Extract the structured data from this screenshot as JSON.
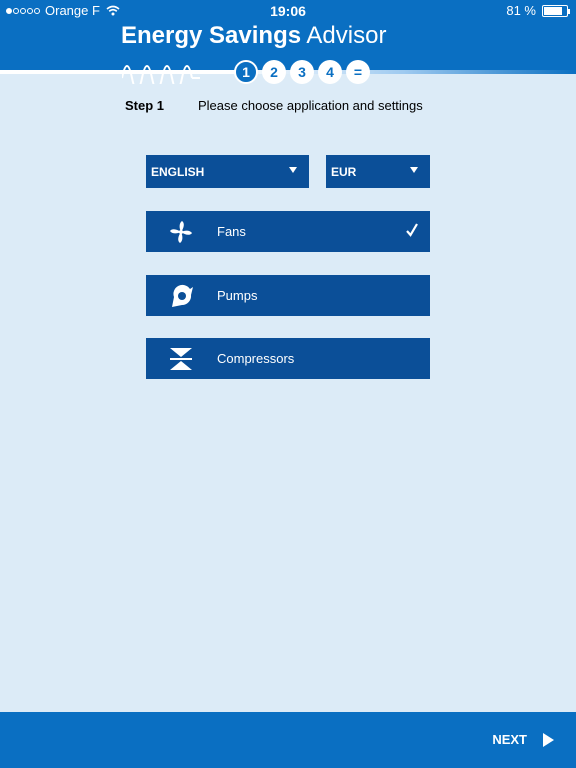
{
  "status_bar": {
    "carrier": "Orange F",
    "time": "19:06",
    "battery": "81 %",
    "battery_level": 0.81,
    "signal_bars": 1
  },
  "header": {
    "title_bold": "Energy Savings",
    "title_light": "Advisor"
  },
  "steps": {
    "items": [
      "1",
      "2",
      "3",
      "4",
      "="
    ],
    "active_index": 0
  },
  "step_header": {
    "label": "Step 1",
    "description": "Please choose application and settings"
  },
  "settings": {
    "language": "ENGLISH",
    "currency": "EUR"
  },
  "applications": [
    {
      "label": "Fans",
      "icon": "fan-icon",
      "selected": true
    },
    {
      "label": "Pumps",
      "icon": "pump-icon",
      "selected": false
    },
    {
      "label": "Compressors",
      "icon": "compressor-icon",
      "selected": false
    }
  ],
  "footer": {
    "next_label": "NEXT"
  },
  "colors": {
    "brand_blue": "#0a6fc2",
    "button_blue": "#0b4f98",
    "background": "#dcebf7"
  }
}
